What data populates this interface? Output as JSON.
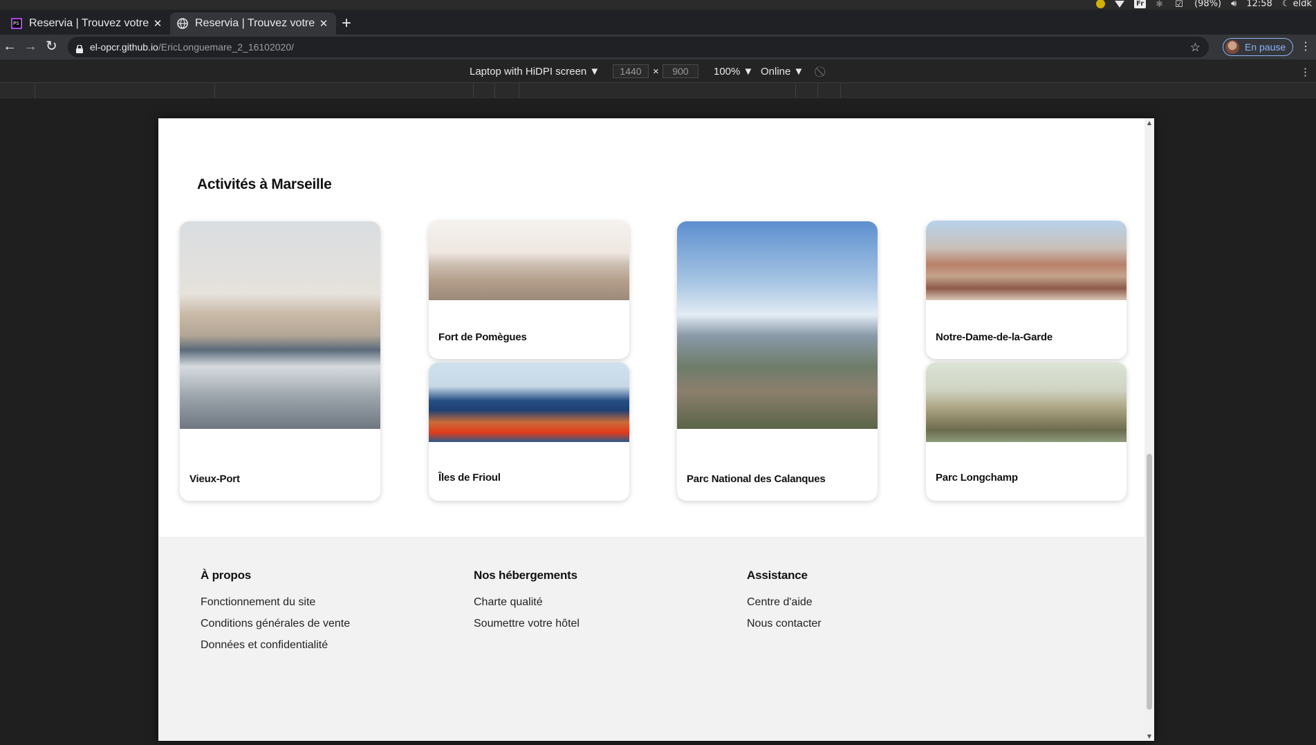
{
  "browser": {
    "tabs": [
      {
        "title": "Reservia | Trouvez votre hébergement",
        "active": false,
        "favicon": "phpstorm-icon"
      },
      {
        "title": "Reservia | Trouvez votre hébergement",
        "active": true,
        "favicon": "globe-icon"
      }
    ],
    "url_host": "el-opcr.github.io",
    "url_path": "/EricLonguemare_2_16102020/",
    "profile_label": "En pause"
  },
  "os": {
    "battery": "(98%)",
    "time": "12:58",
    "user": "eldk",
    "keyboard": "Fr"
  },
  "devtools": {
    "device": "Laptop with HiDPI screen",
    "width": "1440",
    "height": "900",
    "times": "×",
    "zoom": "100%",
    "network": "Online"
  },
  "page": {
    "section_title": "Activités à Marseille",
    "activities": [
      {
        "label": "Vieux-Port"
      },
      {
        "label": "Fort de Pomègues"
      },
      {
        "label": "Îles de Frioul"
      },
      {
        "label": "Parc National des Calanques"
      },
      {
        "label": "Notre-Dame-de-la-Garde"
      },
      {
        "label": "Parc Longchamp"
      }
    ],
    "footer": {
      "col1": {
        "title": "À propos",
        "links": [
          "Fonctionnement du site",
          "Conditions générales de vente",
          "Données et confidentialité"
        ]
      },
      "col2": {
        "title": "Nos hébergements",
        "links": [
          "Charte qualité",
          "Soumettre votre hôtel"
        ]
      },
      "col3": {
        "title": "Assistance",
        "links": [
          "Centre d'aide",
          "Nous contacter"
        ]
      }
    }
  }
}
